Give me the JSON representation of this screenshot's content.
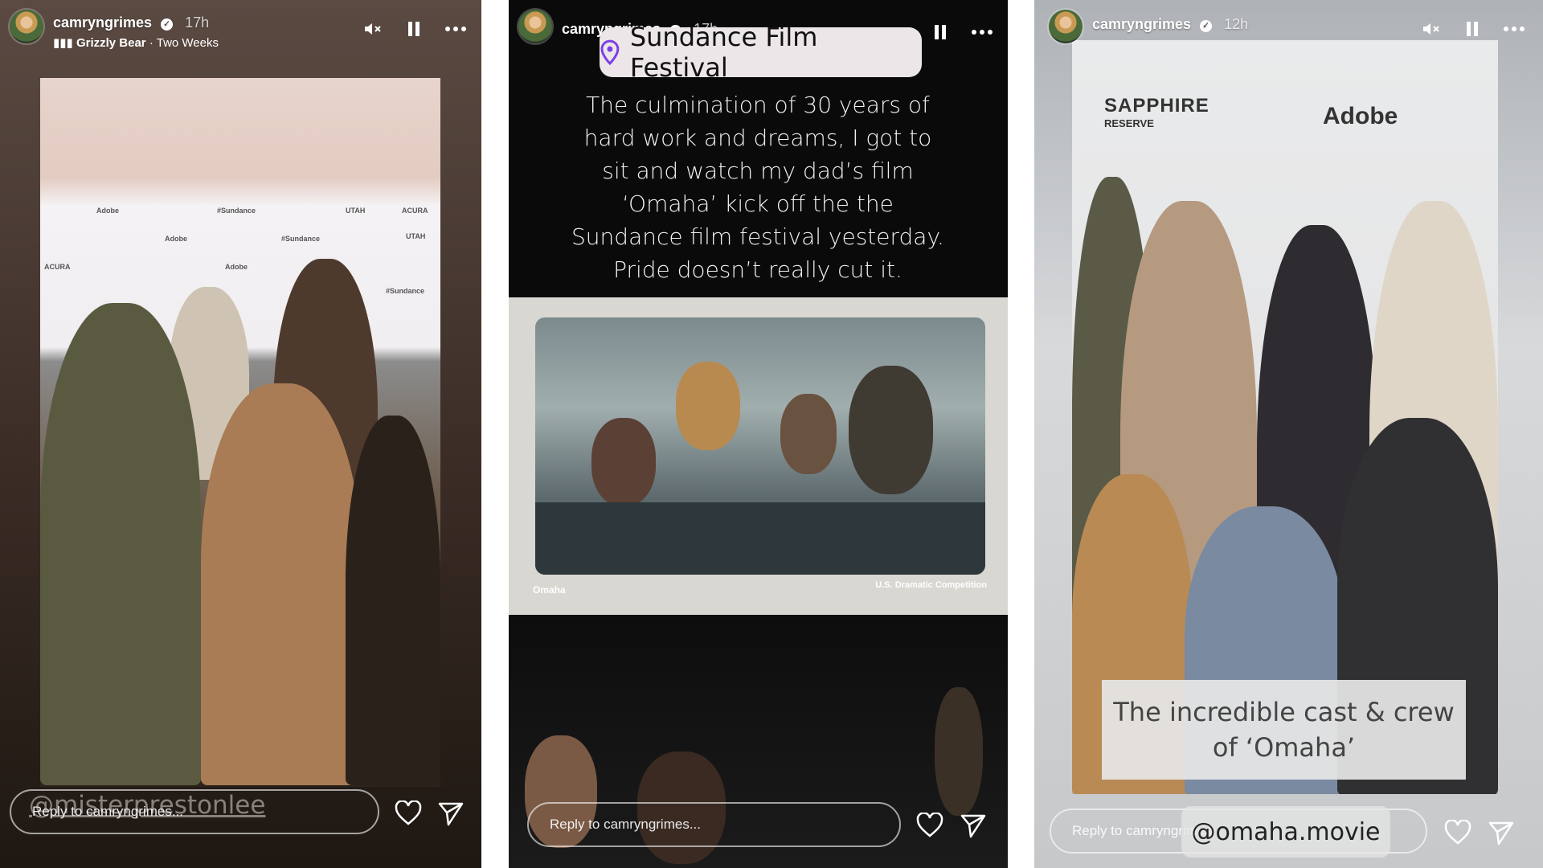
{
  "stories": [
    {
      "username": "camryngrimes",
      "time": "17h",
      "music_title": "Grizzly Bear",
      "music_artist": "Two Weeks",
      "mention": "@misterprestonlee",
      "reply_placeholder": "Reply to camryngrimes..."
    },
    {
      "username": "camryngrimes",
      "time": "17h",
      "location": "Sundance Film Festival",
      "caption_lines": [
        "The culmination of 30 years of",
        "hard work and dreams, I got to",
        "sit and watch my dad’s film",
        "‘Omaha’ kick off the the",
        "Sundance film festival yesterday.",
        "Pride doesn’t really cut it."
      ],
      "screen_left": "Omaha",
      "screen_right": "U.S. Dramatic Competition",
      "reply_placeholder": "Reply to camryngrimes..."
    },
    {
      "username": "camryngrimes",
      "time": "12h",
      "caption_lines": [
        "The incredible cast & crew",
        "of ‘Omaha’"
      ],
      "mention": "@omaha.movie",
      "sponsors": [
        "SAPPHIRE",
        "RESERVE",
        "Adobe"
      ],
      "reply_placeholder": "Reply to camryngrimes..."
    }
  ],
  "backdrop_logos": [
    "Adobe",
    "#Sundance",
    "UTAH",
    "ACURA",
    "Adobe",
    "#Sundance",
    "UTAH",
    "ACURA",
    "Adobe",
    "#Sundance"
  ],
  "colors": {
    "text": "#ffffff",
    "location_pin": "#7b3fe4"
  },
  "icons": [
    "verified-icon",
    "music-bars-icon",
    "mute-icon",
    "pause-icon",
    "more-icon",
    "heart-icon",
    "send-icon",
    "location-pin-icon"
  ]
}
